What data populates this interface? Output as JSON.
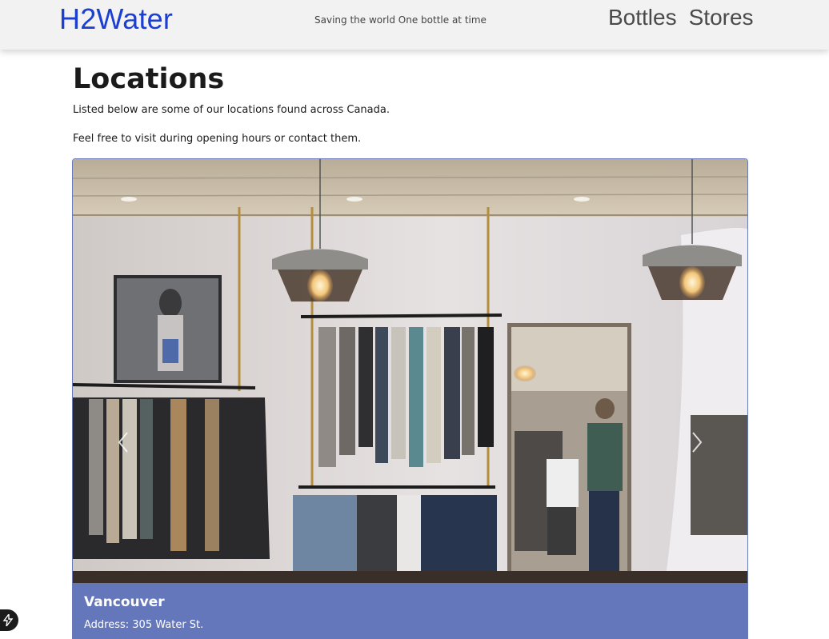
{
  "header": {
    "brand": "H2Water",
    "tagline": "Saving the world One bottle at time",
    "nav": [
      {
        "label": "Bottles"
      },
      {
        "label": "Stores"
      }
    ]
  },
  "main": {
    "title": "Locations",
    "intro_line1": "Listed below are some of our locations found across Canada.",
    "intro_line2": "Feel free to visit during opening hours or contact them."
  },
  "carousel": {
    "prev_icon": "chevron-left-icon",
    "next_icon": "chevron-right-icon",
    "caption": {
      "city": "Vancouver",
      "address": "Address: 305 Water St."
    }
  },
  "colors": {
    "brand": "#1a3fd1",
    "caption_bg": "#6577bb",
    "header_bg": "#f2f2f2"
  },
  "fab_icon": "lightning-icon"
}
